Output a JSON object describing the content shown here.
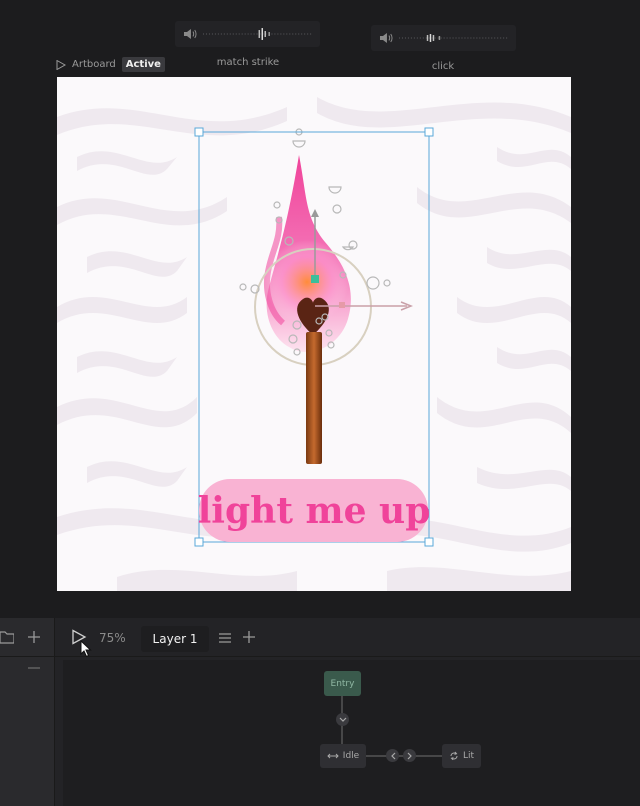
{
  "audio_tracks": [
    {
      "name": "match strike"
    },
    {
      "name": "click"
    }
  ],
  "artboard": {
    "label": "Artboard",
    "status": "Active",
    "artwork_text": "light me up"
  },
  "timeline": {
    "zoom": "75%",
    "layer_tab": "Layer 1"
  },
  "state_machine": {
    "entry_label": "Entry",
    "idle_label": "Idle",
    "lit_label": "Lit"
  },
  "colors": {
    "accent_pink": "#f0439a",
    "entry_node": "#3a5a4c",
    "selection_blue": "#5aa8d8"
  }
}
